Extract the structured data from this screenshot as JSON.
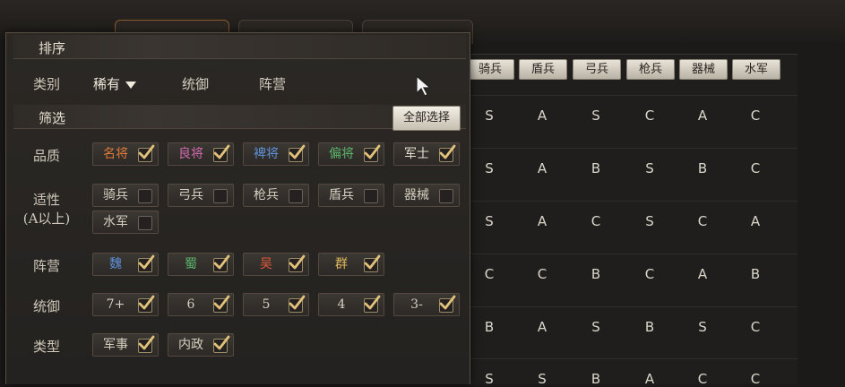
{
  "colors": {
    "mingjiang": "#e07a3c",
    "liangjiang": "#d06ab0",
    "pijiang": "#5f90d8",
    "pianjiang": "#5bb36b",
    "junshi": "#e6dfd1",
    "wei": "#5f90d8",
    "shu": "#5bb36b",
    "wu": "#e05a3c",
    "qun": "#e0b85c"
  },
  "panel": {
    "sort_title": "排序",
    "filter_title": "筛选",
    "select_all": "全部选择"
  },
  "sort": {
    "label": "类别",
    "tabs": [
      {
        "label": "稀有",
        "active": true
      },
      {
        "label": "统御",
        "active": false
      },
      {
        "label": "阵营",
        "active": false
      }
    ]
  },
  "filters": {
    "quality": {
      "label": "品质",
      "options": [
        {
          "label": "名将",
          "checked": true
        },
        {
          "label": "良将",
          "checked": true
        },
        {
          "label": "裨将",
          "checked": true
        },
        {
          "label": "偏将",
          "checked": true
        },
        {
          "label": "军士",
          "checked": true
        }
      ]
    },
    "aptitude": {
      "label_line1": "适性",
      "label_line2": "(A以上)",
      "options": [
        {
          "label": "骑兵",
          "checked": false
        },
        {
          "label": "弓兵",
          "checked": false
        },
        {
          "label": "枪兵",
          "checked": false
        },
        {
          "label": "盾兵",
          "checked": false
        },
        {
          "label": "器械",
          "checked": false
        },
        {
          "label": "水军",
          "checked": false
        }
      ]
    },
    "faction": {
      "label": "阵营",
      "options": [
        {
          "label": "魏",
          "checked": true
        },
        {
          "label": "蜀",
          "checked": true
        },
        {
          "label": "吴",
          "checked": true
        },
        {
          "label": "群",
          "checked": true
        }
      ]
    },
    "command": {
      "label": "统御",
      "options": [
        {
          "label": "7+",
          "checked": true
        },
        {
          "label": "6",
          "checked": true
        },
        {
          "label": "5",
          "checked": true
        },
        {
          "label": "4",
          "checked": true
        },
        {
          "label": "3-",
          "checked": true
        }
      ]
    },
    "type": {
      "label": "类型",
      "options": [
        {
          "label": "军事",
          "checked": true
        },
        {
          "label": "内政",
          "checked": true
        }
      ]
    }
  },
  "table": {
    "headers": [
      "骑兵",
      "盾兵",
      "弓兵",
      "枪兵",
      "器械",
      "水军"
    ],
    "rows": [
      [
        "S",
        "A",
        "S",
        "C",
        "A",
        "C"
      ],
      [
        "S",
        "A",
        "B",
        "S",
        "B",
        "C"
      ],
      [
        "S",
        "A",
        "C",
        "S",
        "C",
        "A"
      ],
      [
        "C",
        "C",
        "B",
        "C",
        "A",
        "B"
      ],
      [
        "B",
        "A",
        "S",
        "B",
        "S",
        "C"
      ],
      [
        "S",
        "S",
        "B",
        "A",
        "C",
        "C"
      ]
    ]
  }
}
